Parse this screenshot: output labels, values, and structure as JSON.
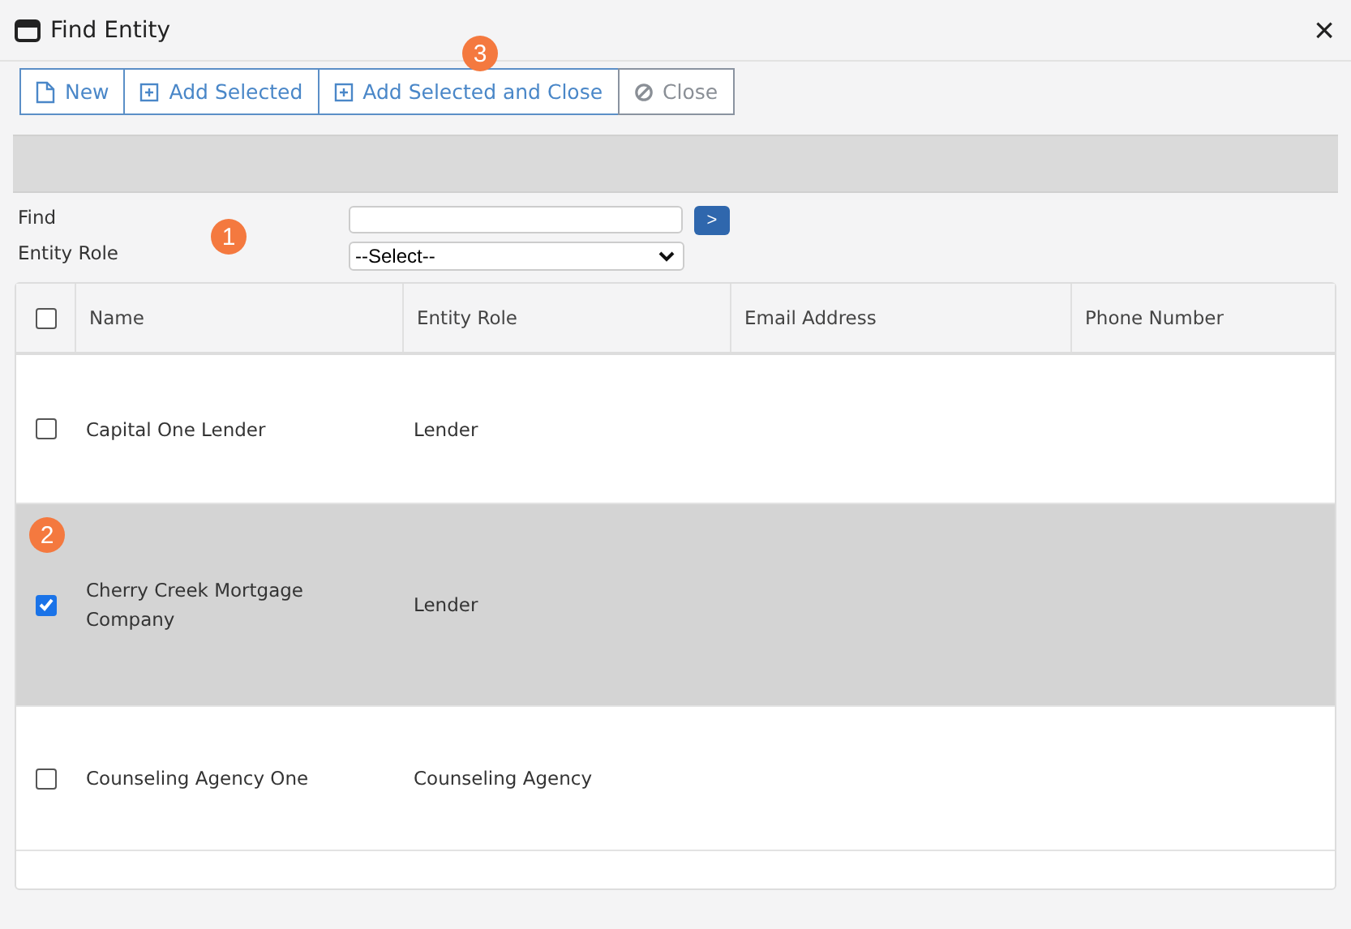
{
  "window": {
    "title": "Find Entity",
    "close": "×"
  },
  "toolbar": [
    {
      "label": "New",
      "kind": "new"
    },
    {
      "label": "Add Selected",
      "kind": "add"
    },
    {
      "label": "Add Selected and Close",
      "kind": "add"
    },
    {
      "label": "Close",
      "kind": "close"
    }
  ],
  "form": {
    "find_label": "Find",
    "go": ">",
    "role_label": "Entity Role",
    "role_value": "--Select--"
  },
  "table": {
    "select_all": false,
    "columns": [
      "Name",
      "Entity Role",
      "Email Address",
      "Phone Number"
    ],
    "rows": [
      {
        "selected": false,
        "cells": [
          "Capital One Lender",
          "Lender"
        ]
      },
      {
        "selected": true,
        "cells": [
          "Cherry Creek Mortgage Company",
          "Lender"
        ]
      },
      {
        "selected": false,
        "cells": [
          "Counseling Agency One",
          "Counseling Agency"
        ]
      }
    ]
  },
  "callouts": [
    {
      "number": "3",
      "kind": "toolbar"
    },
    {
      "number": "1",
      "kind": "form"
    },
    {
      "number": "2",
      "kind": "row"
    }
  ]
}
